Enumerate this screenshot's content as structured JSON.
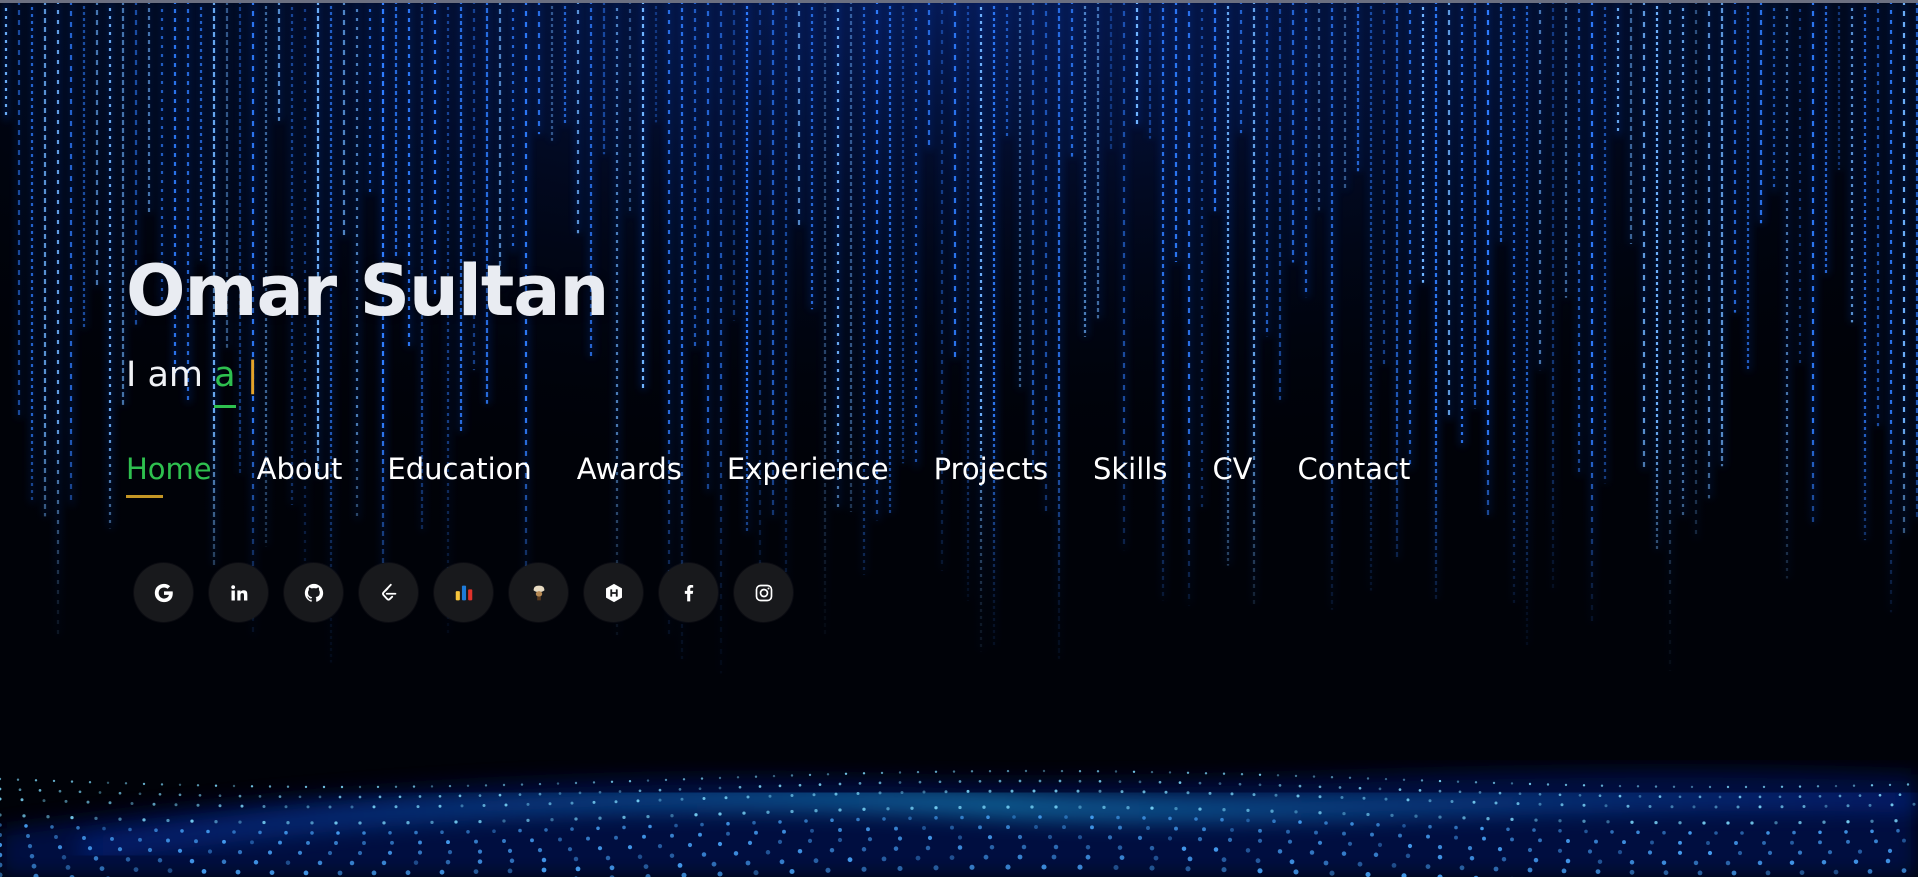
{
  "hero": {
    "name": "Omar Sultan",
    "tagline_prefix": "I am ",
    "tagline_typed": "a",
    "tagline_cursor": "|"
  },
  "nav": {
    "items": [
      {
        "label": "Home",
        "active": true
      },
      {
        "label": "About"
      },
      {
        "label": "Education"
      },
      {
        "label": "Awards"
      },
      {
        "label": "Experience"
      },
      {
        "label": "Projects"
      },
      {
        "label": "Skills"
      },
      {
        "label": "CV"
      },
      {
        "label": "Contact"
      }
    ]
  },
  "social": {
    "icons": [
      "google-icon",
      "linkedin-icon",
      "github-icon",
      "leetcode-icon",
      "codeforces-icon",
      "codechef-icon",
      "hackerrank-icon",
      "facebook-icon",
      "instagram-icon"
    ]
  },
  "colors": {
    "accent_green": "#2ec04f",
    "accent_gold": "#c49625",
    "matrix_blue": "#1a6dff",
    "background": "#000208"
  }
}
